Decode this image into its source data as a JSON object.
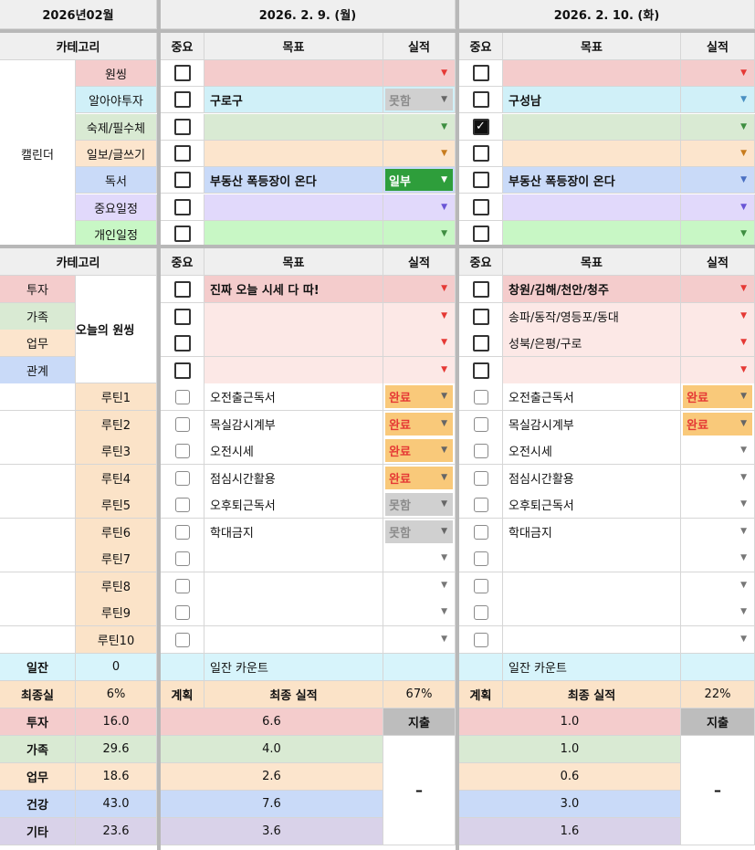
{
  "month_label": "2026년02월",
  "days": [
    {
      "date": "2026. 2. 9. (월)",
      "col_priority": "중요",
      "col_goal": "목표",
      "col_result": "실적"
    },
    {
      "date": "2026. 2. 10. (화)",
      "col_priority": "중요",
      "col_goal": "목표",
      "col_result": "실적"
    }
  ],
  "calendar": {
    "header": "카테고리",
    "group_label": "캘린더",
    "rows": [
      {
        "label": "원씽",
        "color": "#f4cccc",
        "d1": {
          "checked": false,
          "goal": "",
          "result": ""
        },
        "d2": {
          "checked": false,
          "goal": "",
          "result": ""
        }
      },
      {
        "label": "알아야투자",
        "color": "#d0f0f8",
        "d1": {
          "checked": false,
          "goal": "구로구",
          "result": "못함"
        },
        "d2": {
          "checked": false,
          "goal": "구성남",
          "result": ""
        }
      },
      {
        "label": "숙제/필수체",
        "color": "#d9ead3",
        "d1": {
          "checked": false,
          "goal": "",
          "result": ""
        },
        "d2": {
          "checked": true,
          "goal": "",
          "result": ""
        }
      },
      {
        "label": "일보/글쓰기",
        "color": "#fce5cd",
        "d1": {
          "checked": false,
          "goal": "",
          "result": ""
        },
        "d2": {
          "checked": false,
          "goal": "",
          "result": ""
        }
      },
      {
        "label": "독서",
        "color": "#c9daf8",
        "d1": {
          "checked": false,
          "goal": "부동산 폭등장이 온다",
          "result": "일부"
        },
        "d2": {
          "checked": false,
          "goal": "부동산 폭등장이 온다",
          "result": ""
        }
      },
      {
        "label": "중요일정",
        "color": "#e1d9fb",
        "d1": {
          "checked": false,
          "goal": "",
          "result": ""
        },
        "d2": {
          "checked": false,
          "goal": "",
          "result": ""
        }
      },
      {
        "label": "개인일정",
        "color": "#c8f7c5",
        "d1": {
          "checked": false,
          "goal": "",
          "result": ""
        },
        "d2": {
          "checked": false,
          "goal": "",
          "result": ""
        }
      }
    ]
  },
  "oneThing": {
    "header": "카테고리",
    "categories": [
      {
        "label": "투자",
        "color": "#f4cccc"
      },
      {
        "label": "가족",
        "color": "#d9ead3"
      },
      {
        "label": "업무",
        "color": "#fce5cd"
      },
      {
        "label": "관계",
        "color": "#c9daf8"
      }
    ],
    "group_label": "오늘의 원씽",
    "rows": [
      {
        "d1": {
          "goal": "진짜 오늘 시세 다 따!"
        },
        "d2": {
          "goal": "창원/김해/천안/청주"
        }
      },
      {
        "d1": {
          "goal": ""
        },
        "d2": {
          "goal": "송파/동작/영등포/동대"
        }
      },
      {
        "d1": {
          "goal": ""
        },
        "d2": {
          "goal": "성북/은평/구로"
        }
      },
      {
        "d1": {
          "goal": ""
        },
        "d2": {
          "goal": ""
        }
      }
    ]
  },
  "routines": [
    {
      "label": "루틴1",
      "d1": {
        "goal": "오전출근독서",
        "result": "완료"
      },
      "d2": {
        "goal": "오전출근독서",
        "result": "완료"
      }
    },
    {
      "label": "루틴2",
      "d1": {
        "goal": "목실감시계부",
        "result": "완료"
      },
      "d2": {
        "goal": "목실감시계부",
        "result": "완료"
      }
    },
    {
      "label": "루틴3",
      "d1": {
        "goal": "오전시세",
        "result": "완료"
      },
      "d2": {
        "goal": "오전시세",
        "result": ""
      }
    },
    {
      "label": "루틴4",
      "d1": {
        "goal": "점심시간활용",
        "result": "완료"
      },
      "d2": {
        "goal": "점심시간활용",
        "result": ""
      }
    },
    {
      "label": "루틴5",
      "d1": {
        "goal": "오후퇴근독서",
        "result": "못함"
      },
      "d2": {
        "goal": "오후퇴근독서",
        "result": ""
      }
    },
    {
      "label": "루틴6",
      "d1": {
        "goal": "학대금지",
        "result": "못함"
      },
      "d2": {
        "goal": "학대금지",
        "result": ""
      }
    },
    {
      "label": "루틴7",
      "d1": {
        "goal": "",
        "result": ""
      },
      "d2": {
        "goal": "",
        "result": ""
      }
    },
    {
      "label": "루틴8",
      "d1": {
        "goal": "",
        "result": ""
      },
      "d2": {
        "goal": "",
        "result": ""
      }
    },
    {
      "label": "루틴9",
      "d1": {
        "goal": "",
        "result": ""
      },
      "d2": {
        "goal": "",
        "result": ""
      }
    },
    {
      "label": "루틴10",
      "d1": {
        "goal": "",
        "result": ""
      },
      "d2": {
        "goal": "",
        "result": ""
      }
    }
  ],
  "streak": {
    "label": "일잔",
    "value": "0",
    "d1_text": "일잔 카운트",
    "d2_text": "일잔 카운트"
  },
  "final": {
    "label": "최종실",
    "value": "6%",
    "plan_label": "계획",
    "result_label": "최종 실적",
    "d1_pct": "67%",
    "d2_pct": "22%"
  },
  "categoryStats": {
    "expense_label": "지출",
    "dash": "–",
    "rows": [
      {
        "label": "투자",
        "value": "16.0",
        "color": "#f4cccc",
        "d1": "6.6",
        "d2": "1.0"
      },
      {
        "label": "가족",
        "value": "29.6",
        "color": "#d9ead3",
        "d1": "4.0",
        "d2": "1.0"
      },
      {
        "label": "업무",
        "value": "18.6",
        "color": "#fce5cd",
        "d1": "2.6",
        "d2": "0.6"
      },
      {
        "label": "건강",
        "value": "43.0",
        "color": "#c9daf8",
        "d1": "7.6",
        "d2": "3.0"
      },
      {
        "label": "기타",
        "value": "23.6",
        "color": "#d9d2e9",
        "d1": "3.6",
        "d2": "1.6"
      }
    ]
  },
  "colors": {
    "header_gray": "#efefef",
    "label_gray": "#e6e6e6",
    "row_pink": "#fce8e6",
    "cyan": "#d7f4fb",
    "orange": "#fbe3c8",
    "done": "#f9c97a",
    "done_text": "#e53935",
    "partial": "#2e9e3b",
    "notdone": "#d0d0d0",
    "notdone_text": "#8c8c8c",
    "expense": "#bdbdbd"
  }
}
